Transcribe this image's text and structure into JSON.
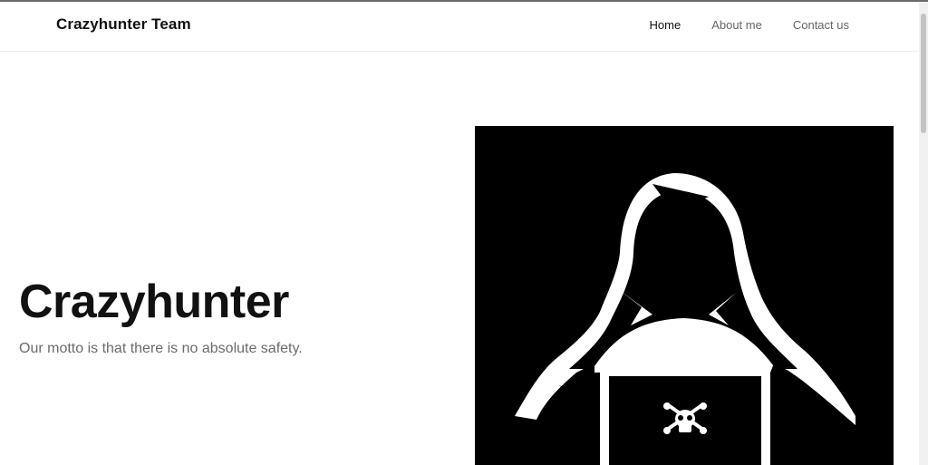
{
  "nav": {
    "brand": "Crazyhunter Team",
    "links": [
      {
        "label": "Home",
        "active": true
      },
      {
        "label": "About me",
        "active": false
      },
      {
        "label": "Contact us",
        "active": false
      }
    ]
  },
  "hero": {
    "title": "Crazyhunter",
    "motto": "Our motto is that there is no absolute safety.",
    "image_icon": "hooded-hacker-icon",
    "laptop_icon": "skull-crossbones-icon"
  },
  "colors": {
    "text_dark": "#111111",
    "text_muted": "#666666",
    "image_bg": "#000000"
  }
}
